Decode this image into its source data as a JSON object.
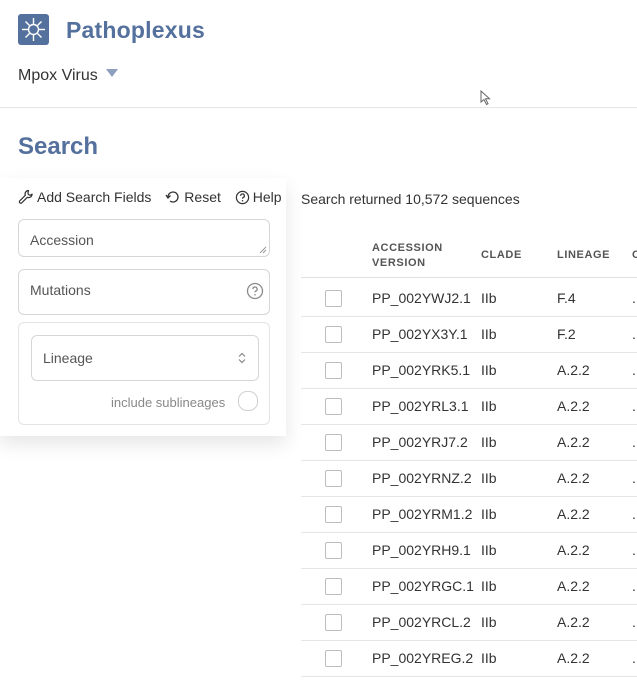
{
  "header": {
    "brand": "Pathoplexus",
    "organism": "Mpox Virus"
  },
  "page_title": "Search",
  "search_panel": {
    "add_fields_label": "Add Search Fields",
    "reset_label": "Reset",
    "help_label": "Help",
    "accession_label": "Accession",
    "mutations_label": "Mutations",
    "lineage_label": "Lineage",
    "include_sublineages_label": "include sublineages"
  },
  "results": {
    "summary": "Search returned 10,572 sequences",
    "columns": {
      "accession_line1": "ACCESSION",
      "accession_line2": "VERSION",
      "clade": "CLADE",
      "lineage": "LINEAGE",
      "next": "C"
    },
    "rows": [
      {
        "accession": "PP_002YWJ2.1",
        "clade": "IIb",
        "lineage": "F.4",
        "next": "."
      },
      {
        "accession": "PP_002YX3Y.1",
        "clade": "IIb",
        "lineage": "F.2",
        "next": "."
      },
      {
        "accession": "PP_002YRK5.1",
        "clade": "IIb",
        "lineage": "A.2.2",
        "next": "."
      },
      {
        "accession": "PP_002YRL3.1",
        "clade": "IIb",
        "lineage": "A.2.2",
        "next": "."
      },
      {
        "accession": "PP_002YRJ7.2",
        "clade": "IIb",
        "lineage": "A.2.2",
        "next": "."
      },
      {
        "accession": "PP_002YRNZ.2",
        "clade": "IIb",
        "lineage": "A.2.2",
        "next": "."
      },
      {
        "accession": "PP_002YRM1.2",
        "clade": "IIb",
        "lineage": "A.2.2",
        "next": "."
      },
      {
        "accession": "PP_002YRH9.1",
        "clade": "IIb",
        "lineage": "A.2.2",
        "next": "."
      },
      {
        "accession": "PP_002YRGC.1",
        "clade": "IIb",
        "lineage": "A.2.2",
        "next": "."
      },
      {
        "accession": "PP_002YRCL.2",
        "clade": "IIb",
        "lineage": "A.2.2",
        "next": "."
      },
      {
        "accession": "PP_002YREG.2",
        "clade": "IIb",
        "lineage": "A.2.2",
        "next": "."
      }
    ]
  },
  "colors": {
    "brand": "#54709c",
    "border": "#d6d6d6"
  }
}
